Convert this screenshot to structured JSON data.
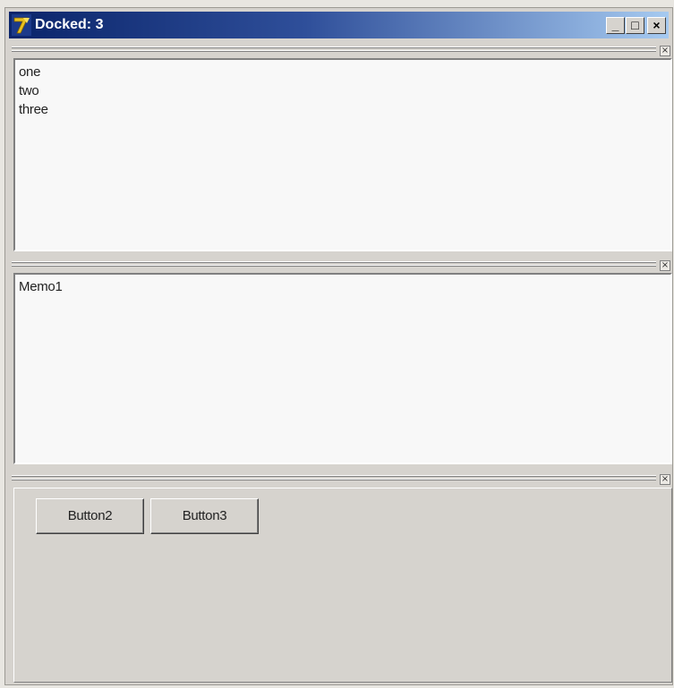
{
  "window": {
    "title": "Docked: 3",
    "icon": "delphi-app-icon",
    "controls": {
      "minimize": "_",
      "maximize": "□",
      "close": "×"
    }
  },
  "dock_close_glyph": "×",
  "memo_list": {
    "lines": [
      "one",
      "two",
      "three"
    ]
  },
  "memo1": {
    "text": "Memo1"
  },
  "panel": {
    "buttons": [
      "Button2",
      "Button3"
    ]
  },
  "colors": {
    "title_start": "#0a246a",
    "title_end": "#a6caf0",
    "face": "#d6d3ce",
    "memo_bg": "#f8f8f8"
  }
}
